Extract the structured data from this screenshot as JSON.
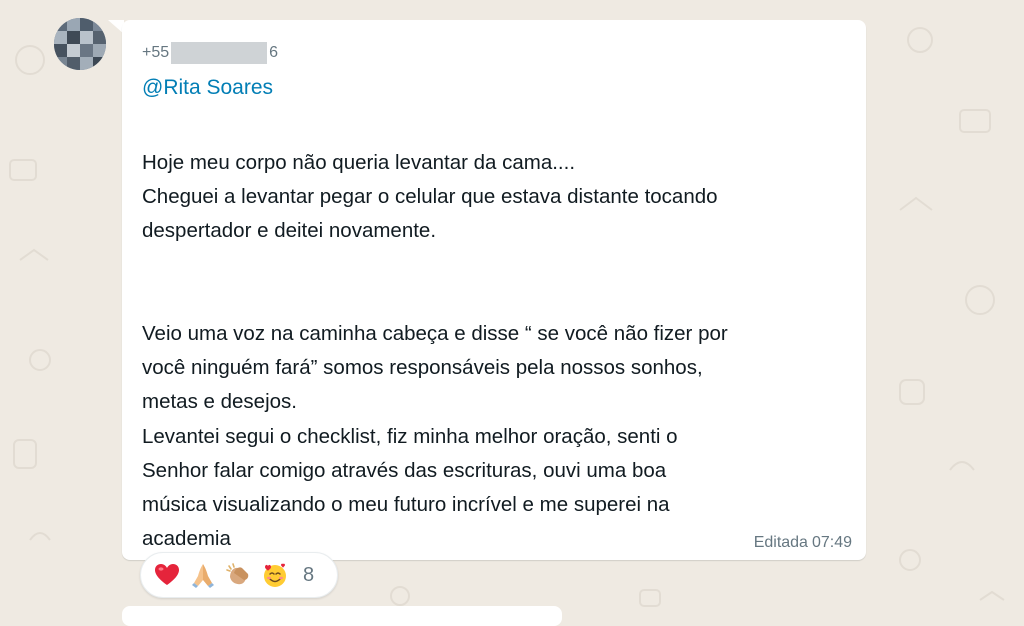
{
  "message": {
    "sender_phone_prefix": "+55",
    "sender_phone_suffix": "6",
    "mention": "@Rita Soares",
    "lines": [
      "Hoje meu corpo não queria levantar da cama....",
      "Cheguei a levantar pegar o celular que estava distante tocando",
      "despertador e deitei novamente.",
      "",
      "",
      "Veio uma voz na caminha cabeça e disse “ se você não fizer por",
      "você ninguém fará” somos responsáveis pela nossos sonhos,",
      "metas e desejos.",
      "Levantei segui o checklist, fiz minha melhor oração, senti o",
      "Senhor falar comigo através das escrituras, ouvi uma boa",
      "música visualizando o meu futuro incrível e me superei na",
      "academia"
    ],
    "edited_label": "Editada",
    "time": "07:49"
  },
  "reactions": {
    "emojis": [
      "red-heart-icon",
      "folded-hands-icon",
      "clapping-hands-icon",
      "smiling-face-with-hearts-icon"
    ],
    "count": "8"
  },
  "colors": {
    "chat_background": "#efeae2",
    "bubble": "#ffffff",
    "mention": "#027eb5",
    "meta_text": "#667781"
  }
}
